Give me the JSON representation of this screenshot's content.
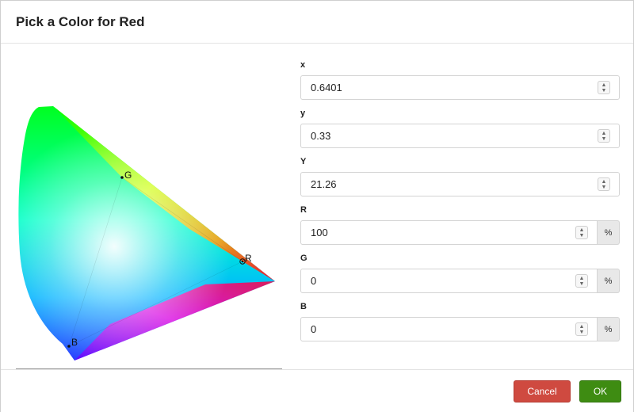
{
  "dialog": {
    "title": "Pick a Color for Red"
  },
  "diagram": {
    "points": [
      {
        "id": "r",
        "label": "R"
      },
      {
        "id": "g",
        "label": "G"
      },
      {
        "id": "b",
        "label": "B"
      }
    ]
  },
  "fields": [
    {
      "id": "x",
      "label": "x",
      "value": "0.6401",
      "unit": ""
    },
    {
      "id": "y",
      "label": "y",
      "value": "0.33",
      "unit": ""
    },
    {
      "id": "Y",
      "label": "Y",
      "value": "21.26",
      "unit": ""
    },
    {
      "id": "R",
      "label": "R",
      "value": "100",
      "unit": "%"
    },
    {
      "id": "G",
      "label": "G",
      "value": "0",
      "unit": "%"
    },
    {
      "id": "B",
      "label": "B",
      "value": "0",
      "unit": "%"
    }
  ],
  "footer": {
    "cancel_label": "Cancel",
    "ok_label": "OK"
  },
  "colors": {
    "cancel": "#cf4a40",
    "ok": "#3e8c12",
    "selected_color": "#ff0000"
  }
}
